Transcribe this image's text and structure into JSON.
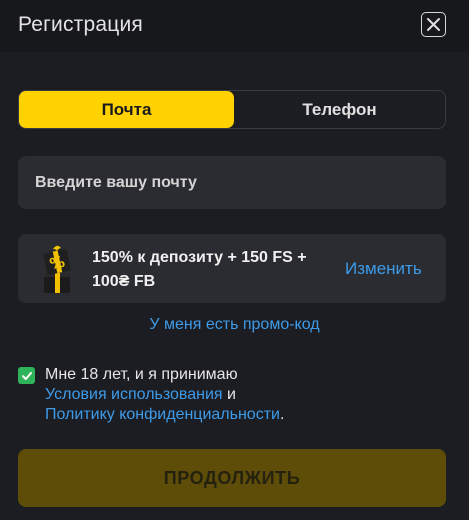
{
  "header": {
    "title": "Регистрация"
  },
  "tabs": [
    {
      "label": "Почта",
      "active": true
    },
    {
      "label": "Телефон",
      "active": false
    }
  ],
  "email": {
    "placeholder": "Введите вашу почту"
  },
  "bonus": {
    "text": "150% к депозиту + 150 FS + 100₴ FB",
    "change_label": "Изменить"
  },
  "promo": {
    "label": "У меня есть промо-код"
  },
  "agreement": {
    "checked": true,
    "text_before": "Мне 18 лет, и я принимаю",
    "terms_link": "Условия использования",
    "conjunction": "и",
    "privacy_link": "Политику конфиденциальности",
    "period": "."
  },
  "continue_button": {
    "label": "ПРОДОЛЖИТЬ"
  },
  "colors": {
    "accent": "#ffd200",
    "link": "#3d9be9",
    "checkbox": "#2fb35a",
    "background": "#1c1d22",
    "field": "#2b2c31"
  }
}
